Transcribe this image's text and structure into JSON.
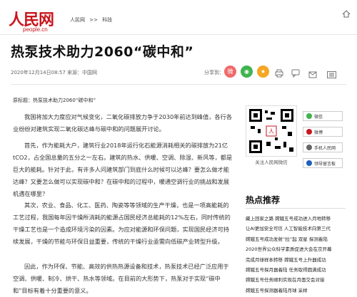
{
  "header": {
    "logo_text": "人民网",
    "logo_site": "people.cn",
    "breadcrumb": [
      "人民网",
      ">>",
      "科技"
    ]
  },
  "article": {
    "title": "热泵技术助力2060“碳中和”",
    "meta": "2020年12月14日08:57  来源：中国网",
    "share_label": "分享到：",
    "source_line": "原标题：热泵技术助力2060“碳中和”",
    "paragraphs": [
      "我国将加大力度应对气候变化，二氧化碳排放力争于2030年前达到峰值，各行各业纷纷对建筑实现二氧化碳达峰与碳中和的问题展开讨论。",
      "首先，作为能耗大户，建筑行业2018年运行化石能源消耗相关的碳排放为21亿tCO2，占全国总量的五分之一左右。建筑的热水、供暖、空调、除湿、新风等，都是巨大的能耗。针对于此，有许多人问建筑部门到底什么时候可以达峰？要怎么做才能达峰？又要怎么做可以实现碳中和？在碳中和的过程中，暖通空调行业的挑战和发展机遇在哪里？",
      "其次，农业、食品、化工、医药、陶瓷等等领域的生产干燥，也是一项高能耗的工艺过程，我国每年因干燥所消耗的能源占国民经济总能耗的12%左右，同时传统的干燥工艺也是一个造成环境污染的因素。为应对能源和环保问题，实现国民经济可持续发展，干燥的节能与环保日益重要，传统的干燥行业亟需向低碳产业转型升级。",
      "因此，作为环保、节能、高效的供热热源设备和技术，热泵技术已经广泛应用于空调、供暖、制冷、烘干、热水等领域。在目前的大形势下，热泵对于实现“碳中和”目标有着十分重要的意义。"
    ]
  },
  "sidebar": {
    "qr_caption": "关注人民网微信",
    "boxes": [
      "微信",
      "微博",
      "手机人民网",
      "领导留言板"
    ],
    "hot_title": "热点推荐",
    "hot_items": [
      "藏上回家之路 嫦娥五号成功进入月地转移",
      "让AI更加安全可信 人工智能技术向第三代",
      "嫦娥五号成功发射“拉”起 双星 探测着陆",
      "2020世界公众科学素质促进大会在京开幕",
      "完成月球样本转移 嫦娥五号上升器成功",
      "嫦娥五号探月器着陆 任务取得圆满成功",
      "嫦娥五号任务顺利实现在月面交会对接",
      "嫦娥五号探测器着陆月球 采样"
    ]
  },
  "colors": {
    "brand_red": "#c8161d",
    "weibo": "#f06a6a",
    "wechat": "#3fb34f",
    "qzone": "#f5a623"
  },
  "icons": [
    "home-icon",
    "weibo-icon",
    "wechat-icon",
    "qzone-icon",
    "print-icon",
    "comment-icon",
    "email-icon",
    "menu-icon"
  ]
}
